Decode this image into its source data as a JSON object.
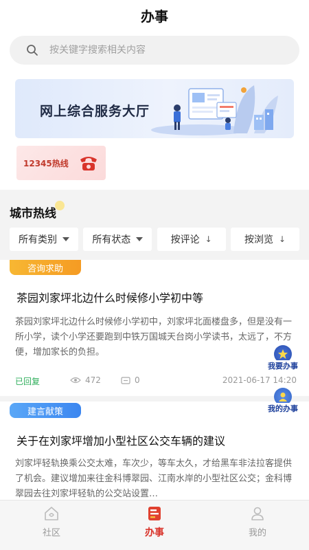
{
  "header": {
    "title": "办事"
  },
  "search": {
    "placeholder": "按关键字搜索相关内容"
  },
  "banner": {
    "title": "网上综合服务大厅"
  },
  "hotline": {
    "label": "12345热线"
  },
  "section": {
    "title": "城市热线"
  },
  "filters": [
    {
      "label": "所有类别",
      "type": "dropdown"
    },
    {
      "label": "所有状态",
      "type": "dropdown"
    },
    {
      "label": "按评论",
      "type": "sort"
    },
    {
      "label": "按浏览",
      "type": "sort"
    }
  ],
  "sort_arrow": "↓",
  "posts": [
    {
      "tag": "咨询求助",
      "title": "茶园刘家坪北边什么时候修小学初中等",
      "body": "茶园刘家坪北边什么时候修小学初中，刘家坪北面楼盘多，但是没有一所小学，读个小学还要跑到中铁万国城天台岗小学读书，太远了，不方便，增加家长的负担。",
      "status": "已回复",
      "views": "472",
      "comments": "0",
      "date": "2021-06-17 14:20"
    },
    {
      "tag": "建言献策",
      "title": "关于在刘家坪增加小型社区公交车辆的建议",
      "body": "刘家坪轻轨换乘公交太难，车次少，等车太久，才给黑车非法拉客提供了机会。建议增加来往金科博翠园、江南水岸的小型社区公交；金科博翠园去往刘家坪轻轨的公交站设置…"
    }
  ],
  "float_buttons": [
    {
      "label": "我要办事",
      "icon": "star-icon"
    },
    {
      "label": "我的办事",
      "icon": "person-icon"
    }
  ],
  "tabs": [
    {
      "label": "社区",
      "icon": "community-home-icon",
      "active": false
    },
    {
      "label": "办事",
      "icon": "task-list-icon",
      "active": true
    },
    {
      "label": "我的",
      "icon": "user-icon",
      "active": false
    }
  ],
  "colors": {
    "accent_red": "#d9342b",
    "tag_orange": "#f59b23",
    "tag_blue": "#3b86f0",
    "status_green": "#2eae5b",
    "float_label": "#1c3f9b"
  }
}
